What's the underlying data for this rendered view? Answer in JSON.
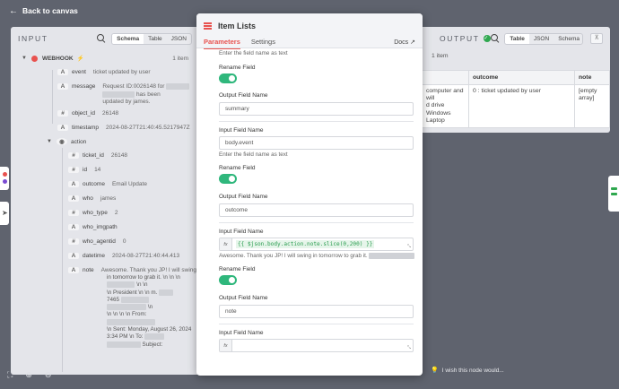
{
  "topbar": {
    "back_label": "Back to canvas"
  },
  "input_panel": {
    "title": "INPUT",
    "view_tabs": [
      "Schema",
      "Table",
      "JSON"
    ],
    "active_view": "Schema",
    "webhook": {
      "name": "WEBHOOK",
      "items_count": "1 item"
    },
    "fields": [
      {
        "type": "A",
        "key": "event",
        "value": "ticket updated by user"
      },
      {
        "type": "A",
        "key": "message",
        "value": "Request ID:0026148 for",
        "value2": "has been",
        "value3": "updated by james."
      },
      {
        "type": "#",
        "key": "object_id",
        "value": "26148"
      },
      {
        "type": "A",
        "key": "timestamp",
        "value": "2024-08-27T21:40:45.5217947Z"
      }
    ],
    "action": {
      "key": "action",
      "fields": [
        {
          "type": "#",
          "key": "ticket_id",
          "value": "26148"
        },
        {
          "type": "#",
          "key": "id",
          "value": "14"
        },
        {
          "type": "A",
          "key": "outcome",
          "value": "Email Update"
        },
        {
          "type": "A",
          "key": "who",
          "value": "james"
        },
        {
          "type": "#",
          "key": "who_type",
          "value": "2"
        },
        {
          "type": "A",
          "key": "who_imgpath",
          "value": ""
        },
        {
          "type": "#",
          "key": "who_agentid",
          "value": "0"
        },
        {
          "type": "A",
          "key": "datetime",
          "value": "2024-08-27T21:40:44.413"
        },
        {
          "type": "A",
          "key": "note",
          "value": "Awesome. Thank you JP! I will swing"
        }
      ],
      "note_lines": [
        "in tomorrow to grab it. \\n \\n \\n",
        "\\n \\n",
        "\\n President \\n \\n m.",
        "7465",
        "\\n",
        "\\n \\n \\n \\n From:",
        "\\n Sent: Monday, August 26, 2024",
        "3:34 PM \\n To:",
        "Subject:"
      ]
    }
  },
  "modal": {
    "title": "Item Lists",
    "tabs": [
      "Parameters",
      "Settings"
    ],
    "active_tab": "Parameters",
    "docs_label": "Docs",
    "hint_top": "Enter the field name as text",
    "field1": {
      "rename_label": "Rename Field",
      "output_label": "Output Field Name",
      "output_value": "summary"
    },
    "field2": {
      "input_label": "Input Field Name",
      "input_value": "body.event",
      "hint": "Enter the field name as text",
      "rename_label": "Rename Field",
      "output_label": "Output Field Name",
      "output_value": "outcome"
    },
    "field3": {
      "input_label": "Input Field Name",
      "fx_label": "fx",
      "expression": "{{ $json.body.action.note.slice(0,200) }}",
      "preview": "Awesome. Thank you JP! I will swing in tomorrow to grab it.",
      "rename_label": "Rename Field",
      "output_label": "Output Field Name",
      "output_value": "note"
    },
    "field4": {
      "input_label": "Input Field Name",
      "fx_label": "fx"
    }
  },
  "output_panel": {
    "title": "OUTPUT",
    "view_tabs": [
      "Table",
      "JSON",
      "Schema"
    ],
    "active_view": "Table",
    "items_count": "1 item",
    "columns": [
      "",
      "outcome",
      "note"
    ],
    "row": {
      "summary_lines": [
        "computer and will",
        "d drive",
        "Windows",
        "Laptop"
      ],
      "outcome": "0 : ticket updated by user",
      "note_lines": [
        "[empty",
        "array]"
      ]
    }
  },
  "footer": {
    "wish_label": "I wish this node would..."
  },
  "colors": {
    "accent": "#e8524f",
    "toggle_on": "#2fb77c",
    "success": "#2fa84f"
  }
}
